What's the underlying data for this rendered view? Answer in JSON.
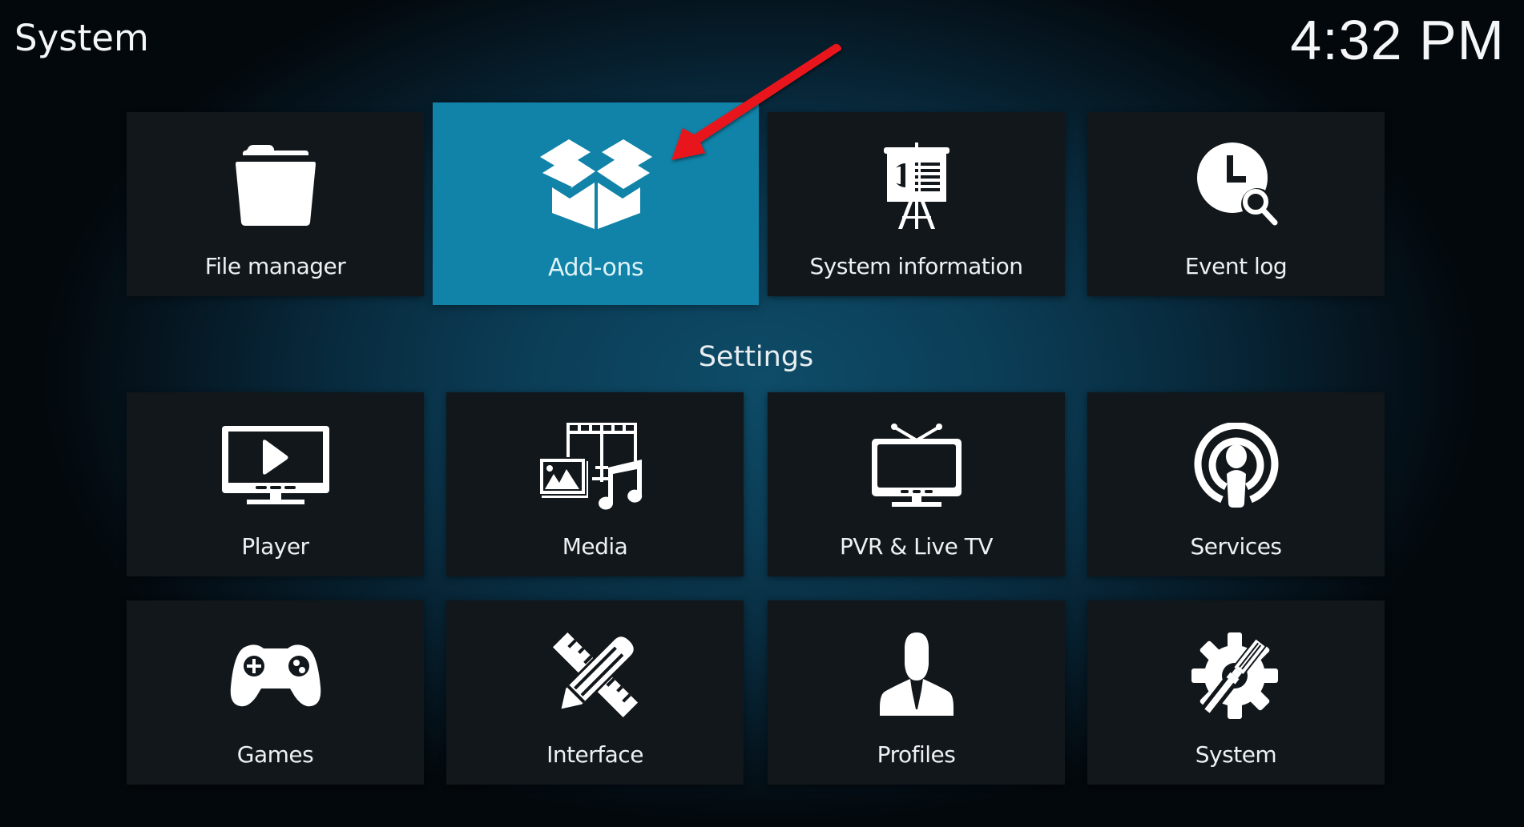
{
  "header": {
    "title": "System",
    "clock": "4:32 PM"
  },
  "top_row": [
    {
      "label": "File manager",
      "icon": "folder-icon"
    },
    {
      "label": "Add-ons",
      "icon": "package-box-icon",
      "focused": true
    },
    {
      "label": "System information",
      "icon": "presentation-board-icon"
    },
    {
      "label": "Event log",
      "icon": "clock-search-icon"
    }
  ],
  "settings": {
    "title": "Settings",
    "items": [
      {
        "label": "Player",
        "icon": "monitor-play-icon"
      },
      {
        "label": "Media",
        "icon": "media-collage-icon"
      },
      {
        "label": "PVR & Live TV",
        "icon": "tv-antenna-icon"
      },
      {
        "label": "Services",
        "icon": "broadcast-person-icon"
      },
      {
        "label": "Games",
        "icon": "gamepad-icon"
      },
      {
        "label": "Interface",
        "icon": "pencil-ruler-icon"
      },
      {
        "label": "Profiles",
        "icon": "user-silhouette-icon"
      },
      {
        "label": "System",
        "icon": "gear-tools-icon"
      }
    ]
  },
  "annotation": {
    "arrow_color": "#e8141b",
    "points_to": "Add-ons"
  },
  "colors": {
    "tile": "#11171b",
    "focused_tile": "#1183a8",
    "background_center": "#0e4c68",
    "background_edge": "#03080c"
  }
}
